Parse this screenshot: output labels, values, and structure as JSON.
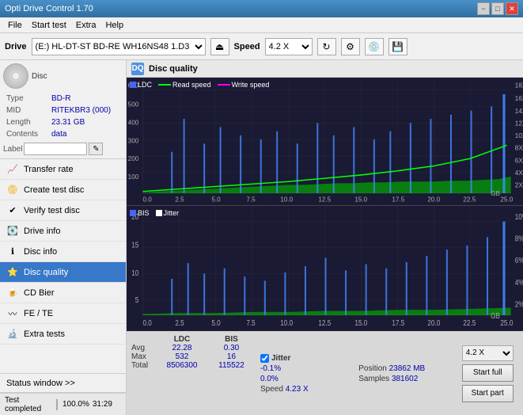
{
  "titlebar": {
    "title": "Opti Drive Control 1.70",
    "minimize": "−",
    "maximize": "□",
    "close": "✕"
  },
  "menubar": {
    "items": [
      "File",
      "Start test",
      "Extra",
      "Help"
    ]
  },
  "toolbar": {
    "drive_label": "Drive",
    "drive_value": "(E:)  HL-DT-ST BD-RE  WH16NS48 1.D3",
    "speed_label": "Speed",
    "speed_value": "4.2 X"
  },
  "disc": {
    "type_label": "Type",
    "type_value": "BD-R",
    "mid_label": "MID",
    "mid_value": "RITEKBR3 (000)",
    "length_label": "Length",
    "length_value": "23.31 GB",
    "contents_label": "Contents",
    "contents_value": "data",
    "label_label": "Label",
    "label_placeholder": ""
  },
  "nav_items": [
    {
      "id": "transfer-rate",
      "label": "Transfer rate",
      "active": false
    },
    {
      "id": "create-test-disc",
      "label": "Create test disc",
      "active": false
    },
    {
      "id": "verify-test-disc",
      "label": "Verify test disc",
      "active": false
    },
    {
      "id": "drive-info",
      "label": "Drive info",
      "active": false
    },
    {
      "id": "disc-info",
      "label": "Disc info",
      "active": false
    },
    {
      "id": "disc-quality",
      "label": "Disc quality",
      "active": true
    },
    {
      "id": "cd-bier",
      "label": "CD Bier",
      "active": false
    },
    {
      "id": "fe-te",
      "label": "FE / TE",
      "active": false
    },
    {
      "id": "extra-tests",
      "label": "Extra tests",
      "active": false
    }
  ],
  "status_window": "Status window >>",
  "progress": {
    "value": 100,
    "text": "100.0%",
    "time": "31:29",
    "status": "Test completed"
  },
  "disc_quality": {
    "title": "Disc quality",
    "legend": {
      "ldc": "LDC",
      "read_speed": "Read speed",
      "write_speed": "Write speed",
      "bis": "BIS",
      "jitter": "Jitter"
    },
    "top_chart": {
      "y_left": [
        "600",
        "500",
        "400",
        "300",
        "200",
        "100"
      ],
      "y_right": [
        "18X",
        "16X",
        "14X",
        "12X",
        "10X",
        "8X",
        "6X",
        "4X",
        "2X"
      ],
      "x_labels": [
        "0.0",
        "2.5",
        "5.0",
        "7.5",
        "10.0",
        "12.5",
        "15.0",
        "17.5",
        "20.0",
        "22.5",
        "25.0"
      ],
      "unit": "GB"
    },
    "bottom_chart": {
      "y_left": [
        "20",
        "15",
        "10",
        "5"
      ],
      "y_right": [
        "10%",
        "8%",
        "6%",
        "4%",
        "2%"
      ],
      "x_labels": [
        "0.0",
        "2.5",
        "5.0",
        "7.5",
        "10.0",
        "12.5",
        "15.0",
        "17.5",
        "20.0",
        "22.5",
        "25.0"
      ],
      "unit": "GB"
    },
    "stats": {
      "headers": [
        "LDC",
        "BIS",
        "",
        "Jitter",
        "Speed",
        ""
      ],
      "avg_label": "Avg",
      "avg_ldc": "22.28",
      "avg_bis": "0.30",
      "avg_jitter": "-0.1%",
      "max_label": "Max",
      "max_ldc": "532",
      "max_bis": "16",
      "max_jitter": "0.0%",
      "total_label": "Total",
      "total_ldc": "8506300",
      "total_bis": "115522",
      "speed_value": "4.23 X",
      "position_label": "Position",
      "position_value": "23862 MB",
      "samples_label": "Samples",
      "samples_value": "381602"
    },
    "buttons": {
      "speed_select": "4.2 X",
      "start_full": "Start full",
      "start_part": "Start part"
    }
  }
}
